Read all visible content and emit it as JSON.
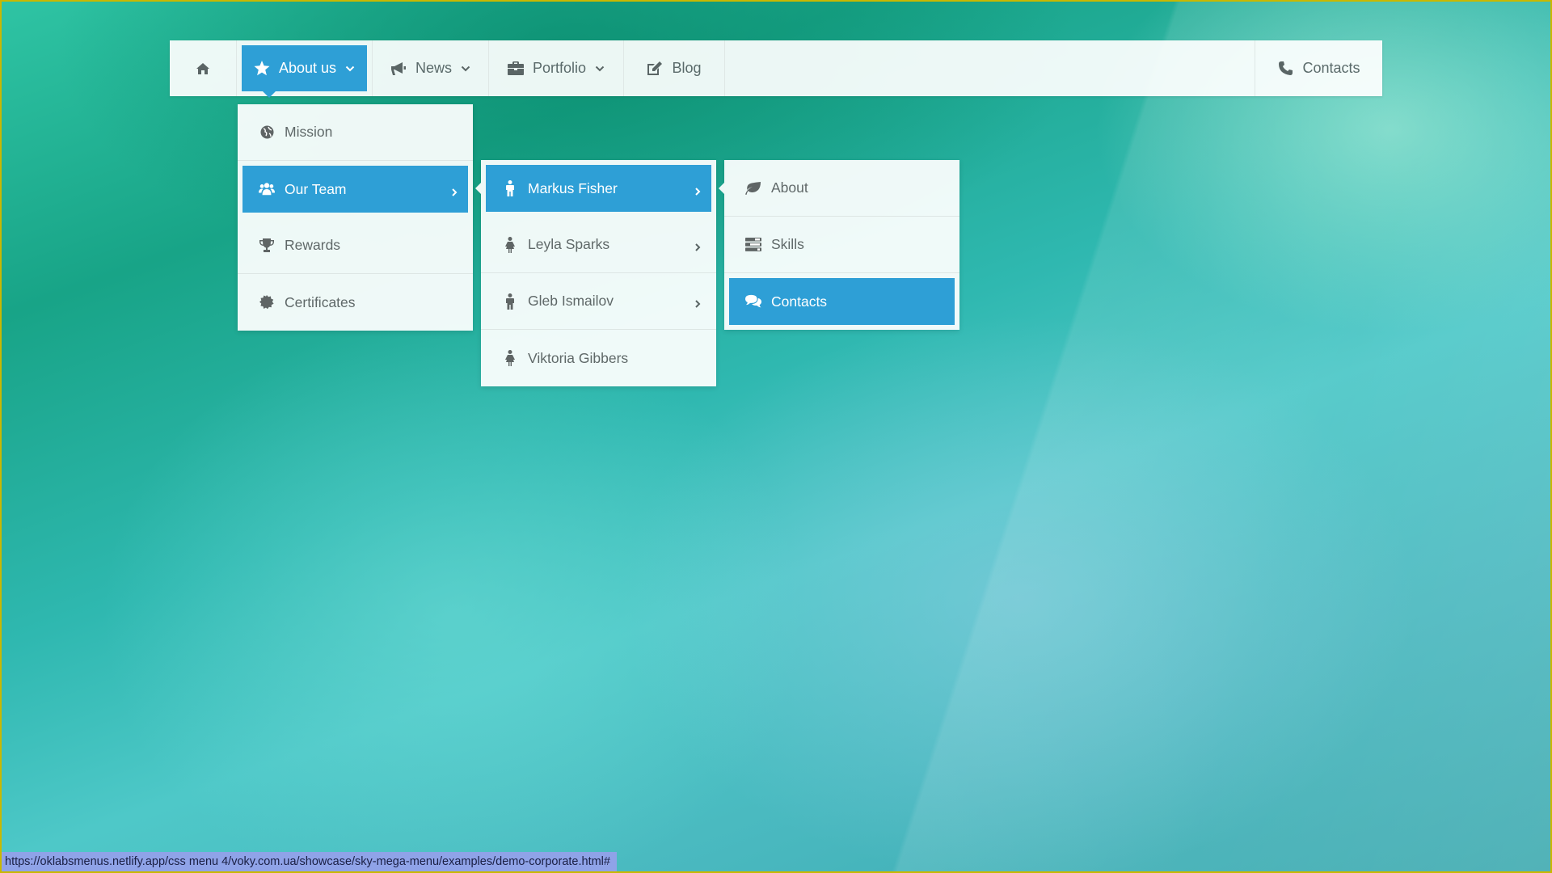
{
  "nav": {
    "home_icon": "home-icon",
    "about_label": "About us",
    "news_label": "News",
    "portfolio_label": "Portfolio",
    "blog_label": "Blog",
    "contacts_label": "Contacts"
  },
  "submenu_about": {
    "items": [
      {
        "label": "Mission",
        "icon": "globe-icon"
      },
      {
        "label": "Our Team",
        "icon": "users-icon",
        "active": true
      },
      {
        "label": "Rewards",
        "icon": "trophy-icon"
      },
      {
        "label": "Certificates",
        "icon": "certificate-icon"
      }
    ]
  },
  "submenu_team": {
    "items": [
      {
        "label": "Markus Fisher",
        "icon": "male-icon",
        "active": true
      },
      {
        "label": "Leyla Sparks",
        "icon": "female-icon"
      },
      {
        "label": "Gleb Ismailov",
        "icon": "male-icon"
      },
      {
        "label": "Viktoria Gibbers",
        "icon": "female-icon"
      }
    ]
  },
  "submenu_person": {
    "items": [
      {
        "label": "About",
        "icon": "leaf-icon"
      },
      {
        "label": "Skills",
        "icon": "tasks-icon"
      },
      {
        "label": "Contacts",
        "icon": "comments-icon",
        "active": true
      }
    ]
  },
  "status": {
    "url": "https://oklabsmenus.netlify.app/css menu 4/voky.com.ua/showcase/sky-mega-menu/examples/demo-corporate.html#"
  },
  "colors": {
    "accent": "#2e9fd6",
    "frame": "#c9b800",
    "statusbar": "#8fa3e8"
  }
}
